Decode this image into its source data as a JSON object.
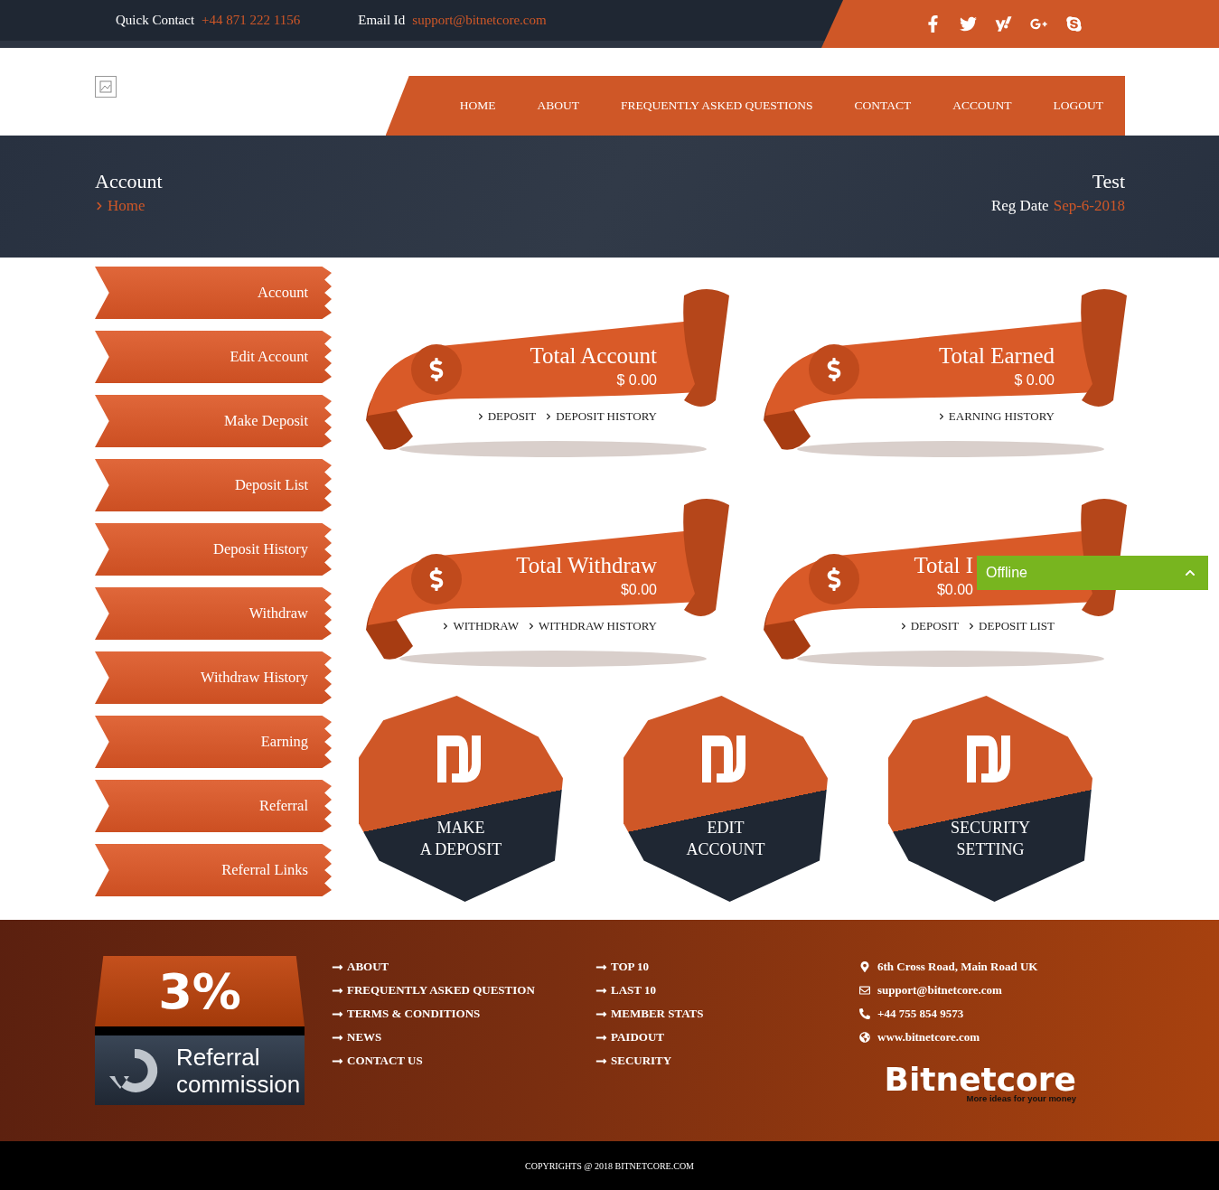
{
  "top_bar": {
    "contact_label": "Quick Contact",
    "phone": "+44 871 222 1156",
    "email_label": "Email Id",
    "email": "support@bitnetcore.com"
  },
  "nav": {
    "items": [
      "HOME",
      "ABOUT",
      "FREQUENTLY ASKED QUESTIONS",
      "CONTACT",
      "ACCOUNT",
      "LOGOUT"
    ]
  },
  "banner": {
    "title": "Account",
    "breadcrumb": "Home",
    "user": "Test",
    "reg_label": "Reg Date",
    "reg_date": "Sep-6-2018"
  },
  "sidebar": {
    "items": [
      "Account",
      "Edit Account",
      "Make Deposit",
      "Deposit List",
      "Deposit History",
      "Withdraw",
      "Withdraw History",
      "Earning",
      "Referral",
      "Referral Links"
    ]
  },
  "stat_cards": [
    {
      "title": "Total Account",
      "amount": "$ 0.00",
      "links": [
        "DEPOSIT",
        "DEPOSIT HISTORY"
      ]
    },
    {
      "title": "Total Earned",
      "amount": "$ 0.00",
      "links": [
        "EARNING HISTORY"
      ]
    },
    {
      "title": "Total Withdraw",
      "amount": "$0.00",
      "links": [
        "WITHDRAW",
        "WITHDRAW HISTORY"
      ]
    },
    {
      "title": "Total I",
      "amount": "$0.00",
      "links": [
        "DEPOSIT",
        "DEPOSIT LIST"
      ]
    }
  ],
  "action_tiles": [
    {
      "lines": [
        "MAKE",
        "A DEPOSIT"
      ]
    },
    {
      "lines": [
        "EDIT",
        "ACCOUNT"
      ]
    },
    {
      "lines": [
        "SECURITY",
        "SETTING"
      ]
    }
  ],
  "chat_widget": {
    "status": "Offline"
  },
  "footer": {
    "promo": {
      "percent": "3%",
      "lines": [
        "Referral",
        "commission"
      ]
    },
    "links_1": [
      "ABOUT",
      "FREQUENTLY ASKED QUESTION",
      "TERMS & CONDITIONS",
      "NEWS",
      "CONTACT US"
    ],
    "links_2": [
      "TOP 10",
      "LAST 10",
      "MEMBER STATS",
      "PAIDOUT",
      "SECURITY"
    ],
    "contact": [
      {
        "kind": "address",
        "text": "6th Cross Road, Main Road UK"
      },
      {
        "kind": "email",
        "text": "support@bitnetcore.com"
      },
      {
        "kind": "phone",
        "text": "+44 755 854 9573"
      },
      {
        "kind": "web",
        "text": "www.bitnetcore.com"
      }
    ],
    "logo": {
      "name": "Bitnetcore",
      "tagline": "More ideas for your money"
    }
  },
  "copyright": "COPYRIGHTS @ 2018 BITNETCORE.COM"
}
